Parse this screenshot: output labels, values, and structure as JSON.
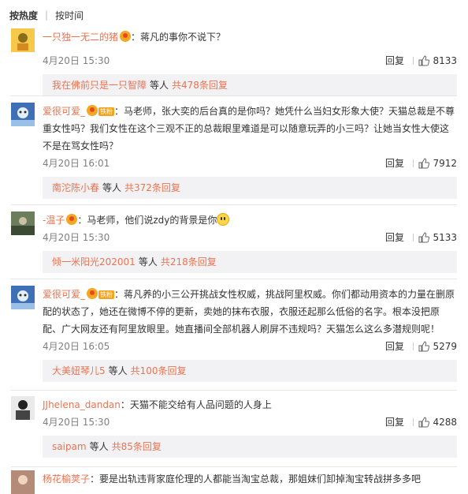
{
  "sort": {
    "hot": "按热度",
    "time": "按时间"
  },
  "comments": [
    {
      "user": "一只独一无二的猪",
      "badges": [
        "vip"
      ],
      "text": "：蒋凡的事你不说下？",
      "time": "4月20日 15:30",
      "reply_label": "回复",
      "likes": "8133",
      "sub": {
        "name": "我在佛前只是一只智障",
        "mid": "等人",
        "count": "共478条回复"
      }
    },
    {
      "user": "爱很可爱_",
      "badges": [
        "vip",
        "铁粉"
      ],
      "text": "：马老师，张大奕的后台真的是你吗？她凭什么当妇女形象大使？天猫总裁是不尊重女性吗？我们女性在这个三观不正的总裁眼里难道是可以随意玩弄的小三吗？让她当女性大使这不是在骂女性吗？",
      "time": "4月20日 16:01",
      "reply_label": "回复",
      "likes": "7912",
      "sub": {
        "name": "南沱陈小春",
        "mid": "等人",
        "count": "共372条回复"
      }
    },
    {
      "user": "-温子",
      "badges": [
        "vip"
      ],
      "text": "：马老师，他们说zdy的背景是你",
      "emoji": "smile-emoji",
      "time": "4月20日 15:30",
      "reply_label": "回复",
      "likes": "5133",
      "sub": {
        "name": "倾一米阳光202001",
        "mid": "等人",
        "count": "共218条回复"
      }
    },
    {
      "user": "爱很可爱_",
      "badges": [
        "vip",
        "铁粉"
      ],
      "text": "：蒋凡养的小三公开挑战女性权威，挑战阿里权威。你们都动用资本的力量在删原配的状态了，她还在微博不停的更新，卖她的抹布衣服，衣服还起那么低俗的名字。根本没把原配、广大网友还有阿里放眼里。她直播间全部机器人刷屏不违规吗？天猫怎么这么多潜规则呢！",
      "time": "4月20日 16:05",
      "reply_label": "回复",
      "likes": "5279",
      "sub": {
        "name": "大美妞琴儿5",
        "mid": "等人",
        "count": "共100条回复"
      }
    },
    {
      "user": "JJhelena_dandan",
      "badges": [],
      "text": "：天猫不能交给有人品问题的人身上",
      "time": "4月20日 15:30",
      "reply_label": "回复",
      "likes": "4288",
      "sub": {
        "name": "saipam",
        "mid": "等人",
        "count": "共85条回复"
      }
    },
    {
      "user": "杨花榆荚子",
      "badges": [],
      "text": "：要是出轨违背家庭伦理的人都能当淘宝总裁，那姐妹们卸掉淘宝转战拼多多吧"
    }
  ],
  "colors": {
    "link": "#eb7350",
    "subbox_bg": "#f2f2f5",
    "vip": "#f5a623"
  },
  "icons": {
    "thumb": "thumbs-up-icon"
  }
}
